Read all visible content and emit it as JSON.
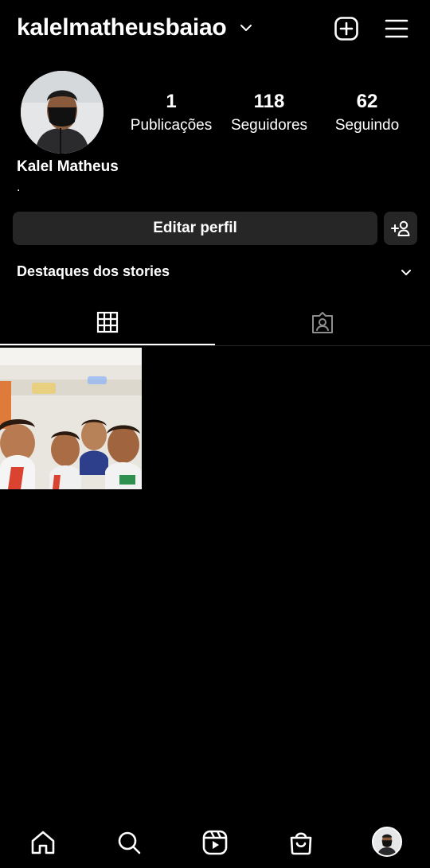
{
  "header": {
    "username": "kalelmatheusbaiao",
    "icons": [
      "chevron-down-icon",
      "new-post-icon",
      "menu-icon"
    ]
  },
  "profile": {
    "avatar_icon": "profile-photo",
    "stats": [
      {
        "value": "1",
        "label": "Publicações"
      },
      {
        "value": "118",
        "label": "Seguidores"
      },
      {
        "value": "62",
        "label": "Seguindo"
      }
    ],
    "full_name": "Kalel Matheus",
    "bio": "."
  },
  "actions": {
    "edit_profile_label": "Editar perfil",
    "discover_people_icon": "add-person-icon"
  },
  "highlights": {
    "title": "Destaques dos stories",
    "icon": "chevron-down-icon"
  },
  "tabs": [
    {
      "icon": "grid-icon",
      "active": true
    },
    {
      "icon": "tagged-icon",
      "active": false
    }
  ],
  "posts": [
    {
      "type": "photo",
      "description_icon": "post-thumbnail"
    }
  ],
  "bottom_nav": [
    "home-icon",
    "search-icon",
    "reels-icon",
    "shop-icon",
    "profile-avatar"
  ],
  "colors": {
    "background": "#000000",
    "button": "#262626",
    "text": "#ffffff",
    "divider": "#262626"
  }
}
